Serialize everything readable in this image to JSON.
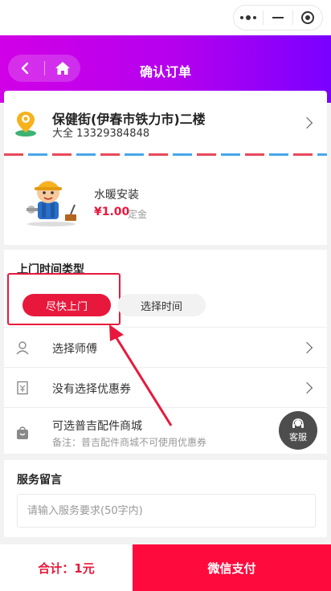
{
  "nav": {
    "title": "确认订单"
  },
  "address": {
    "name": "保健街(伊春市铁力市)二楼",
    "contact": "大全 13329384848"
  },
  "product": {
    "name": "水暖安装",
    "price": "¥1.00",
    "unit": "定金"
  },
  "time_section": {
    "title": "上门时间类型",
    "asap_label": "尽快上门",
    "choose_label": "选择时间"
  },
  "rows": [
    {
      "label": "选择师傅",
      "icon": "person-icon"
    },
    {
      "label": "没有选择优惠券",
      "icon": "coupon-icon"
    },
    {
      "label": "可选普吉配件商城",
      "sub": "备注：普吉配件商城不可使用优惠券",
      "icon": "bag-icon"
    }
  ],
  "support": {
    "label": "客服"
  },
  "note": {
    "title": "服务留言",
    "placeholder": "请输入服务要求(50字内)"
  },
  "footer": {
    "total": "合计：1元",
    "pay_label": "微信支付"
  },
  "colors": {
    "accent": "#e8183c",
    "nav_gradient_start": "#d100e6",
    "nav_gradient_end": "#7a00ff"
  }
}
